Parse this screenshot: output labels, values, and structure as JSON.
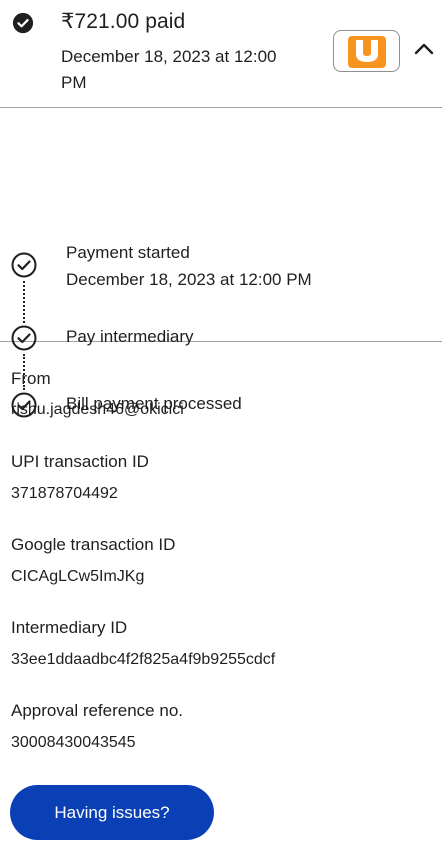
{
  "header": {
    "amount": "₹721.00 paid",
    "datetime": "December 18, 2023 at 12:00 PM",
    "bank_logo_icon": "bank-u-logo-icon",
    "collapse_icon": "chevron-up-icon",
    "colors": {
      "check": "#1f1f1f",
      "logo_orange": "#f7941d"
    }
  },
  "timeline": {
    "steps": [
      {
        "title": "Payment started",
        "subtitle": "December 18, 2023 at 12:00 PM"
      },
      {
        "title": "Pay intermediary"
      },
      {
        "title": "Bill payment processed"
      }
    ]
  },
  "details": {
    "from_label": "From",
    "from_value": "rishu.jagdesh46@okicici",
    "upi_label": "UPI transaction ID",
    "upi_value": "371878704492",
    "google_label": "Google transaction ID",
    "google_value": "CICAgLCw5ImJKg",
    "intermediary_label": "Intermediary ID",
    "intermediary_value": "33ee1ddaadbc4f2f825a4f9b9255cdcf",
    "approval_label": "Approval reference no.",
    "approval_value": "30008430043545"
  },
  "actions": {
    "issues_label": "Having issues?",
    "issues_color": "#0b3fb6"
  }
}
